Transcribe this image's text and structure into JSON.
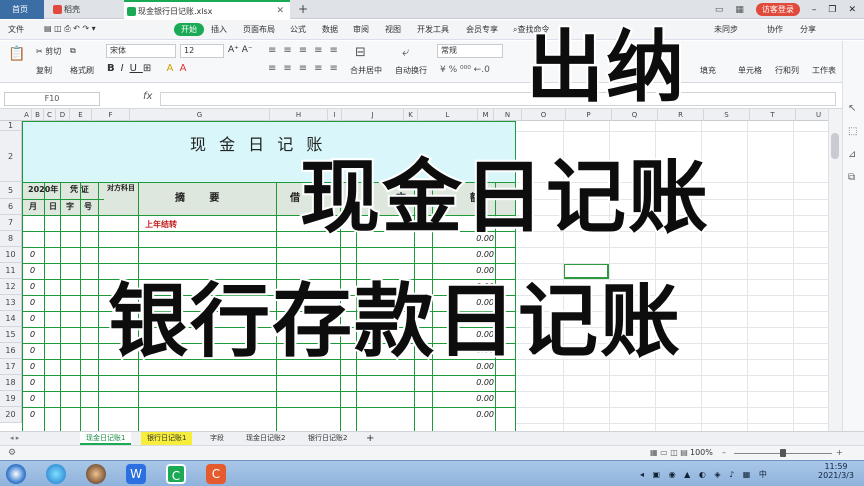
{
  "tabs": {
    "home": "首页",
    "draft": "稻壳",
    "file": "现金银行日记账.xlsx",
    "visitor": "访客登录"
  },
  "menu": [
    "文件",
    "开始",
    "插入",
    "页面布局",
    "公式",
    "数据",
    "审阅",
    "视图",
    "开发工具",
    "会员专享",
    "查找命令",
    "未同步",
    "协作",
    "分享"
  ],
  "ribbon": {
    "cut": "剪切",
    "copy": "复制",
    "format_painter": "格式刷",
    "font": "宋体",
    "font_size": "12",
    "number_format": "常规",
    "merge": "合并居中",
    "wrap": "自动换行",
    "fill": "填充",
    "cell_style": "单元格",
    "rowcol": "行和列",
    "sheet": "工作表",
    "table_style": "表格样式",
    "cond": "条件格式"
  },
  "formula": {
    "namebox": "F10",
    "fx": "fx"
  },
  "columns": [
    "A",
    "B",
    "C",
    "D",
    "E",
    "F",
    "G",
    "H",
    "I",
    "J",
    "K",
    "L",
    "M",
    "N",
    "O",
    "P",
    "Q",
    "R",
    "S",
    "T",
    "U"
  ],
  "rows": [
    "1",
    "2",
    "5",
    "6",
    "7",
    "8",
    "10",
    "11",
    "12",
    "13",
    "14",
    "15",
    "16",
    "17",
    "18",
    "19",
    "20"
  ],
  "sheet": {
    "title": "现 金 日 记 账",
    "year": "2020年",
    "voucher": "凭 证",
    "opp_account": "对方科目",
    "summary": "摘       要",
    "month": "月",
    "day": "日",
    "zi": "字",
    "hao": "号",
    "debit": "借",
    "direction": "方",
    "balance": "额",
    "brought_forward": "上年结转",
    "row_zero": "0",
    "amount_zero": "0.00"
  },
  "overlay": {
    "line1": "出纳",
    "line2": "现金日记账",
    "line3": "银行存款日记账"
  },
  "sheet_tabs": [
    "现金日记账1",
    "银行日记账1",
    "字段",
    "现金日记账2",
    "银行日记账2"
  ],
  "status": {
    "zoom": "100%"
  },
  "taskbar": {
    "time": "11:59",
    "date": "2021/3/3"
  }
}
